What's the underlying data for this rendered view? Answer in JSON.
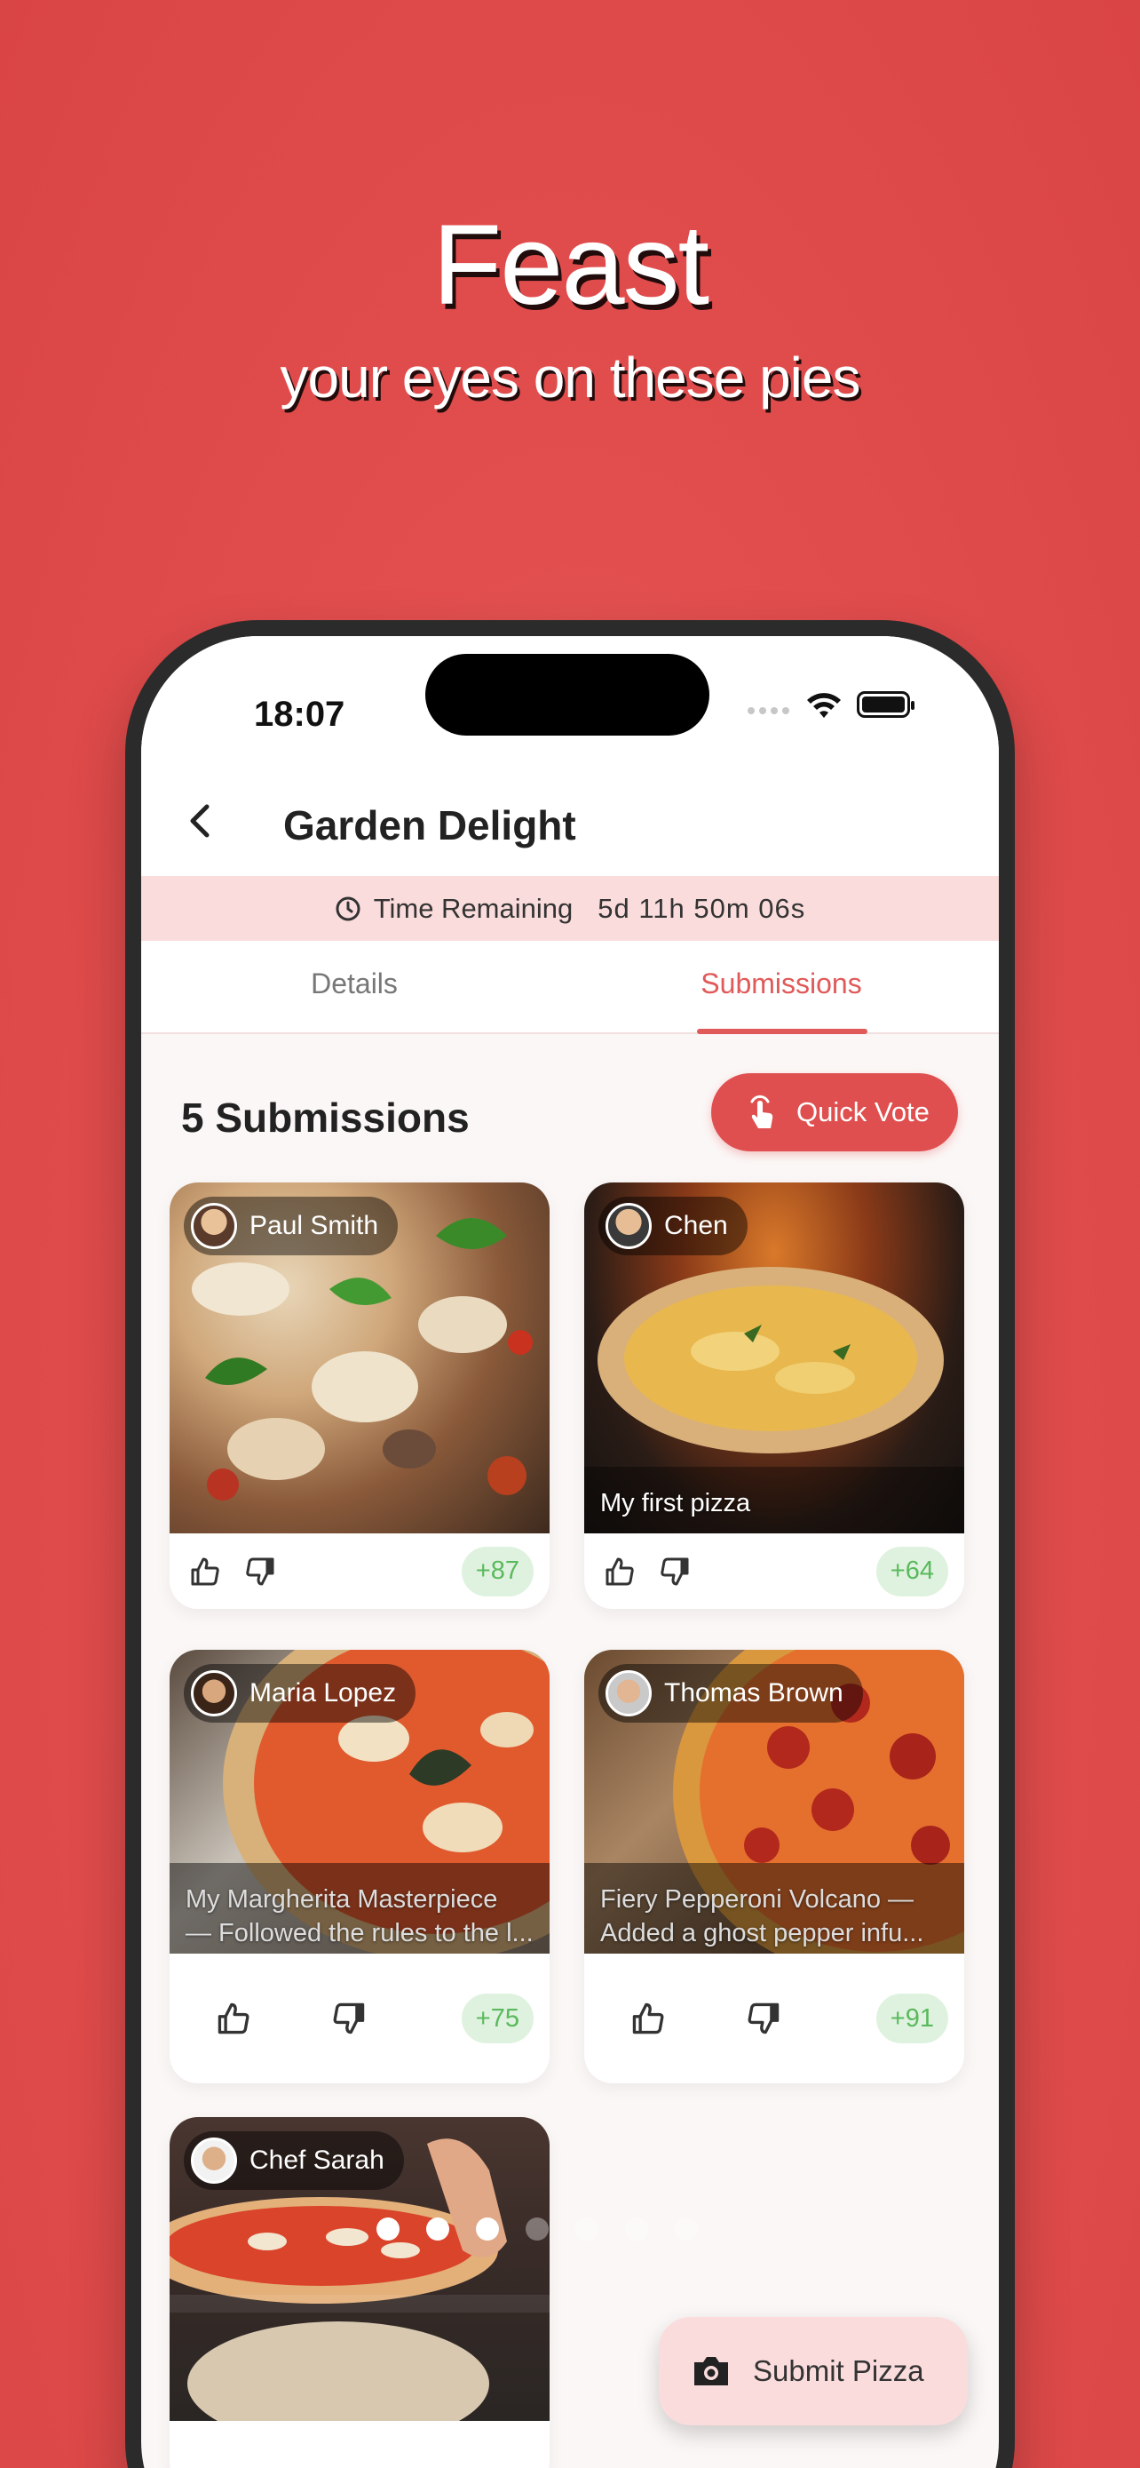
{
  "hero": {
    "title": "Feast",
    "subtitle": "your eyes on these pies"
  },
  "status": {
    "time": "18:07"
  },
  "header": {
    "title": "Garden Delight"
  },
  "timer": {
    "label": "Time Remaining",
    "value": "5d  11h  50m  06s"
  },
  "tabs": [
    {
      "label": "Details"
    },
    {
      "label": "Submissions",
      "active": true
    }
  ],
  "submissions": {
    "count_label": "5 Submissions",
    "quick_vote_label": "Quick Vote"
  },
  "cards": [
    {
      "author": "Paul Smith",
      "caption_lines": [],
      "score": "+87"
    },
    {
      "author": "Chen",
      "caption_lines": [
        "My first pizza"
      ],
      "score": "+64"
    },
    {
      "author": "Maria Lopez",
      "caption_lines": [
        "My Margherita Masterpiece",
        "— Followed the rules to the l..."
      ],
      "score": "+75"
    },
    {
      "author": "Thomas Brown",
      "caption_lines": [
        "Fiery Pepperoni Volcano —",
        "Added a ghost pepper infu..."
      ],
      "score": "+91"
    },
    {
      "author": "Chef Sarah",
      "caption_lines": [],
      "score": ""
    }
  ],
  "fab": {
    "label": "Submit Pizza"
  },
  "carousel": {
    "pages": 7,
    "active_visible": 3
  },
  "colors": {
    "accent": "#e04f4f",
    "timer_bg": "#fbdcdc",
    "score_bg": "#dff2df",
    "score_text": "#5ab95c",
    "background": "#e24e4e"
  }
}
